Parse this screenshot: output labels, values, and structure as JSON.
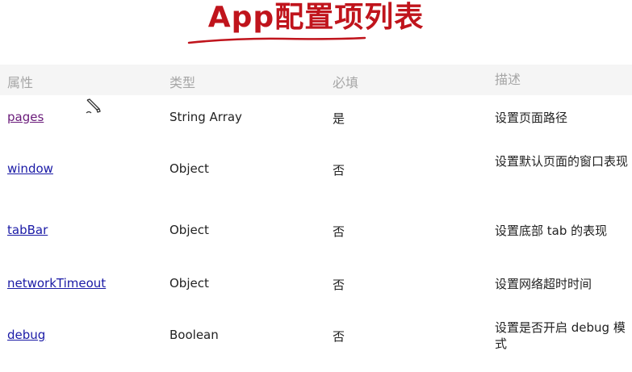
{
  "title": "App配置项列表",
  "colors": {
    "title": "#c0141c",
    "link": "#1a1aa6",
    "visited_link": "#6a1b7a",
    "header_bg": "#f5f5f5",
    "header_text": "#a6a6a6"
  },
  "table": {
    "headers": [
      "属性",
      "类型",
      "必填",
      "描述"
    ],
    "rows": [
      {
        "property": "pages",
        "type": "String Array",
        "required": "是",
        "description": "设置页面路径"
      },
      {
        "property": "window",
        "type": "Object",
        "required": "否",
        "description": "设置默认页面的窗口表现"
      },
      {
        "property": "tabBar",
        "type": "Object",
        "required": "否",
        "description": "设置底部 tab 的表现"
      },
      {
        "property": "networkTimeout",
        "type": "Object",
        "required": "否",
        "description": "设置网络超时时间"
      },
      {
        "property": "debug",
        "type": "Boolean",
        "required": "否",
        "description": "设置是否开启 debug 模式"
      }
    ]
  },
  "cursor_icon": "pencil-cursor-icon"
}
